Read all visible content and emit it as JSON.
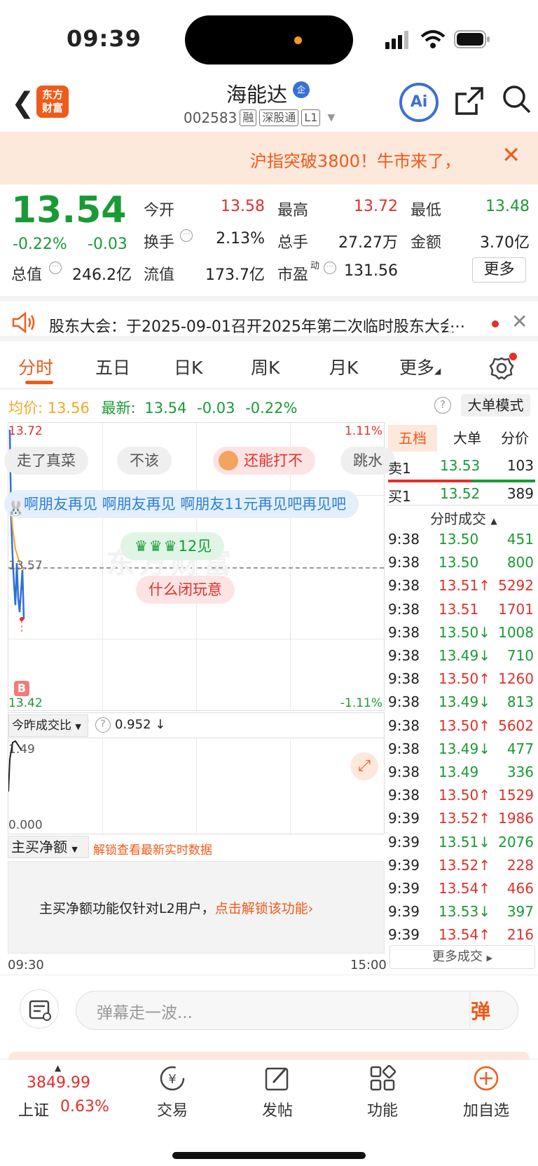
{
  "status": {
    "time": "09:39"
  },
  "header": {
    "logo": "东方\n财富",
    "title": "海能达",
    "badge": "企",
    "code": "002583",
    "tags": [
      "融",
      "深股通",
      "L1"
    ],
    "ai": "Ai"
  },
  "banner": {
    "text": "沪指突破3800！牛市来了，"
  },
  "quote": {
    "price": "13.54",
    "pct": "-0.22%",
    "change": "-0.03",
    "fields": [
      {
        "label": "今开",
        "value": "13.58",
        "color": "red"
      },
      {
        "label": "最高",
        "value": "13.72",
        "color": "red"
      },
      {
        "label": "最低",
        "value": "13.48",
        "color": "green"
      },
      {
        "label": "换手",
        "value": "2.13%",
        "color": "black"
      },
      {
        "label": "总手",
        "value": "27.27万",
        "color": "black"
      },
      {
        "label": "金额",
        "value": "3.70亿",
        "color": "black"
      },
      {
        "label": "总值",
        "value": "246.2亿",
        "color": "black"
      },
      {
        "label": "流值",
        "value": "173.7亿",
        "color": "black"
      },
      {
        "label": "市盈",
        "value": "131.56",
        "color": "black"
      }
    ],
    "pe_sup": "动",
    "more": "更多"
  },
  "notice": {
    "text": "股东大会：于2025-09-01召开2025年第二次临时股东大会"
  },
  "tabs": [
    "分时",
    "五日",
    "日K",
    "周K",
    "月K",
    "更多"
  ],
  "avg": {
    "avg_label": "均价:",
    "avg_value": "13.56",
    "last_label": "最新:",
    "last_value": "13.54",
    "chg": "-0.03",
    "pct": "-0.22%",
    "help": "?",
    "mode": "大单模式"
  },
  "chart": {
    "high_label": "13.72",
    "low_label": "13.42",
    "high_pct": "1.11%",
    "low_pct": "-1.11%",
    "mid_label": "13.57",
    "b_marker": "B",
    "watermark": "东方财富",
    "danmu": [
      "走了真菜",
      "不该",
      "还能打不",
      "跳水",
      "啊朋友再见 啊朋友再见 啊朋友11元再见吧再见吧",
      "12见",
      "什么闭玩意"
    ]
  },
  "volratio": {
    "label": "今昨成交比",
    "help": "?",
    "value": "0.952 ↓",
    "top": "1.49",
    "bottom": "0.000"
  },
  "mainbuy": {
    "label": "主买净额",
    "unlock": "解锁查看最新实时数据",
    "msg": "主买净额功能仅针对L2用户，",
    "link": "点击解锁该功能"
  },
  "time_axis": {
    "start": "09:30",
    "end": "15:00"
  },
  "right_panel": {
    "tabs": [
      "五档",
      "大单",
      "分价"
    ],
    "sell": {
      "label": "卖1",
      "price": "13.53",
      "vol": "103"
    },
    "buy": {
      "label": "买1",
      "price": "13.52",
      "vol": "389"
    },
    "ticks_title": "分时成交",
    "ticks": [
      {
        "t": "9:38",
        "p": "13.50",
        "v": "451",
        "c": "green"
      },
      {
        "t": "9:38",
        "p": "13.50",
        "v": "800",
        "c": "green"
      },
      {
        "t": "9:38",
        "p": "13.51↑",
        "v": "5292",
        "c": "red"
      },
      {
        "t": "9:38",
        "p": "13.51",
        "v": "1701",
        "c": "red"
      },
      {
        "t": "9:38",
        "p": "13.50↓",
        "v": "1008",
        "c": "green"
      },
      {
        "t": "9:38",
        "p": "13.49↓",
        "v": "710",
        "c": "green"
      },
      {
        "t": "9:38",
        "p": "13.50↑",
        "v": "1260",
        "c": "red"
      },
      {
        "t": "9:38",
        "p": "13.49↓",
        "v": "813",
        "c": "green"
      },
      {
        "t": "9:38",
        "p": "13.50↑",
        "v": "5602",
        "c": "red"
      },
      {
        "t": "9:38",
        "p": "13.49↓",
        "v": "477",
        "c": "green"
      },
      {
        "t": "9:38",
        "p": "13.49",
        "v": "336",
        "c": "green"
      },
      {
        "t": "9:38",
        "p": "13.50↑",
        "v": "1529",
        "c": "red"
      },
      {
        "t": "9:39",
        "p": "13.52↑",
        "v": "1986",
        "c": "red"
      },
      {
        "t": "9:39",
        "p": "13.51↓",
        "v": "2076",
        "c": "green"
      },
      {
        "t": "9:39",
        "p": "13.52↑",
        "v": "228",
        "c": "red"
      },
      {
        "t": "9:39",
        "p": "13.54↑",
        "v": "466",
        "c": "red"
      },
      {
        "t": "9:39",
        "p": "13.53↓",
        "v": "397",
        "c": "green"
      },
      {
        "t": "9:39",
        "p": "13.54↑",
        "v": "216",
        "c": "red"
      }
    ],
    "more_ticks": "更多成交"
  },
  "comment": {
    "placeholder": "弹幕走一波...",
    "btn": "弹"
  },
  "bottom_nav": {
    "index_value": "3849.99",
    "index_name": "上证",
    "index_pct": "0.63%",
    "items": [
      "交易",
      "发帖",
      "功能",
      "加自选"
    ]
  },
  "colors": {
    "red": "#e0302b",
    "green": "#1a9a36",
    "orange": "#f05a1a",
    "blue": "#3b6fd8"
  }
}
